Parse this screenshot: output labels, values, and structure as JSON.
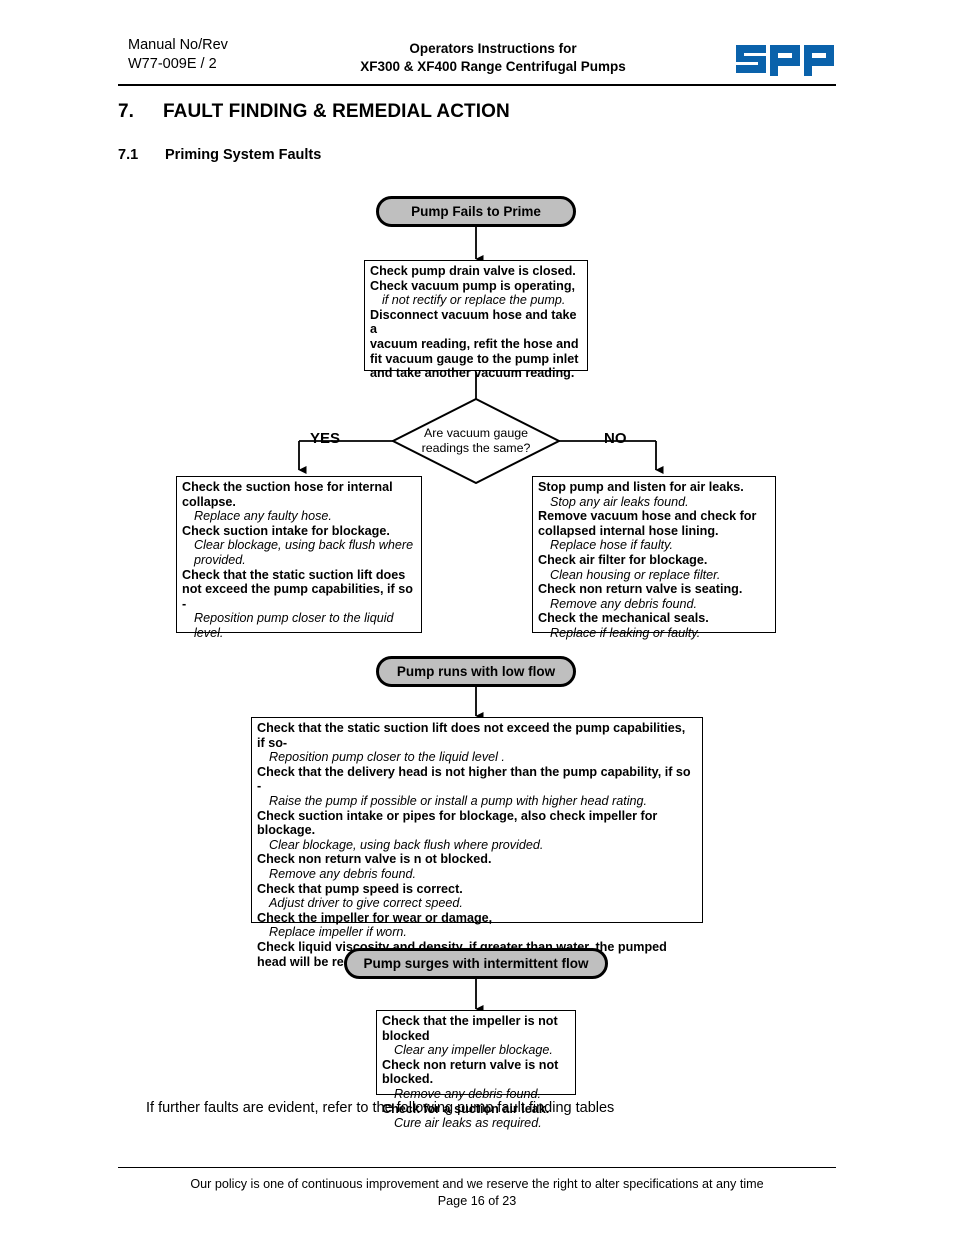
{
  "header": {
    "manual_label": "Manual No/Rev",
    "manual_value": "W77-009E / 2",
    "title_line1": "Operators Instructions for",
    "title_line2": "XF300 & XF400 Range Centrifugal Pumps",
    "logo_text": "spp",
    "logo_color": "#0a62ab"
  },
  "section": {
    "number": "7.",
    "title": "FAULT FINDING & REMEDIAL ACTION",
    "sub_number": "7.1",
    "sub_title": "Priming System Faults"
  },
  "flow": {
    "node1": {
      "label": "Pump Fails to Prime"
    },
    "box1": {
      "lines": [
        {
          "style": "bold",
          "text": "Check pump drain valve is closed."
        },
        {
          "style": "bold",
          "text": "Check vacuum pump is operating,"
        },
        {
          "style": "italic",
          "text": "if not rectify or replace the pump."
        },
        {
          "style": "bold",
          "text": "Disconnect vacuum hose and take a"
        },
        {
          "style": "bold",
          "text": "vacuum reading, refit the hose and"
        },
        {
          "style": "bold",
          "text": "fit vacuum gauge to the pump inlet"
        },
        {
          "style": "bold",
          "text": "and take another vacuum reading."
        }
      ]
    },
    "decision": {
      "line1": "Are vacuum gauge",
      "line2": "readings the same?",
      "yes_label": "YES",
      "no_label": "NO"
    },
    "box_yes": {
      "lines": [
        {
          "style": "bold",
          "text": "Check the suction hose for internal collapse."
        },
        {
          "style": "italic",
          "text": "Replace any faulty hose."
        },
        {
          "style": "bold",
          "text": "Check suction intake for blockage."
        },
        {
          "style": "italic",
          "text": "Clear blockage, using back flush where provided."
        },
        {
          "style": "bold",
          "text": "Check that the static suction lift does not exceed the pump capabilities, if so -"
        },
        {
          "style": "italic",
          "text": "Reposition pump closer to the liquid level."
        }
      ]
    },
    "box_no": {
      "lines": [
        {
          "style": "bold",
          "text": "Stop pump and listen for air leaks."
        },
        {
          "style": "italic",
          "text": "Stop any air leaks found."
        },
        {
          "style": "bold",
          "text": "Remove vacuum hose and check for collapsed internal hose lining."
        },
        {
          "style": "italic",
          "text": "Replace hose if faulty."
        },
        {
          "style": "bold",
          "text": "Check air filter for blockage."
        },
        {
          "style": "italic",
          "text": "Clean housing or replace filter."
        },
        {
          "style": "bold",
          "text": "Check non return valve is seating."
        },
        {
          "style": "italic",
          "text": "Remove any debris found."
        },
        {
          "style": "bold",
          "text": "Check the mechanical seals."
        },
        {
          "style": "italic",
          "text": "Replace if leaking or faulty."
        }
      ]
    },
    "node2": {
      "label": "Pump runs with low flow"
    },
    "box2": {
      "lines": [
        {
          "style": "bold",
          "text": "Check that the static suction lift does not exceed the pump capabilities, if so-"
        },
        {
          "style": "italic",
          "text": "Reposition pump closer to the liquid level ."
        },
        {
          "style": "bold",
          "text": "Check that the  delivery head is not higher than the pump capability, if so -"
        },
        {
          "style": "italic",
          "text": "Raise the pump if possible or install a pump with higher head rating."
        },
        {
          "style": "bold",
          "text": "Check suction intake or pipes for blockage, also check impeller for blockage."
        },
        {
          "style": "italic",
          "text": "Clear blockage, using back flush where provided."
        },
        {
          "style": "bold",
          "text": "Check non return valve is n ot blocked."
        },
        {
          "style": "italic",
          "text": "Remove any debris found."
        },
        {
          "style": "bold",
          "text": "Check that pump speed is correct."
        },
        {
          "style": "italic",
          "text": "Adjust driver to give correct speed."
        },
        {
          "style": "bold",
          "text": "Check the impeller for wear or damage,"
        },
        {
          "style": "italic",
          "text": "Replace impeller if worn."
        },
        {
          "style": "bold",
          "text": "Check liquid viscosity and density, if greater than water, the pumped head will be reduced."
        }
      ]
    },
    "node3": {
      "label": "Pump surges with intermittent flow"
    },
    "box3": {
      "lines": [
        {
          "style": "bold",
          "text": "Check that the impeller is not blocked"
        },
        {
          "style": "italic",
          "text": "Clear any impeller blockage."
        },
        {
          "style": "bold",
          "text": "Check non return valve is not blocked."
        },
        {
          "style": "italic",
          "text": "Remove any debris found."
        },
        {
          "style": "bold",
          "text": "Check for a suction air leak."
        },
        {
          "style": "italic",
          "text": "Cure air leaks as required."
        }
      ]
    }
  },
  "closing_note": "If further faults are evident, refer to the following pump fault finding tables",
  "footer": {
    "policy": "Our policy is one of continuous improvement and we reserve the right to alter specifications at any time",
    "page": "Page 16 of 23"
  }
}
